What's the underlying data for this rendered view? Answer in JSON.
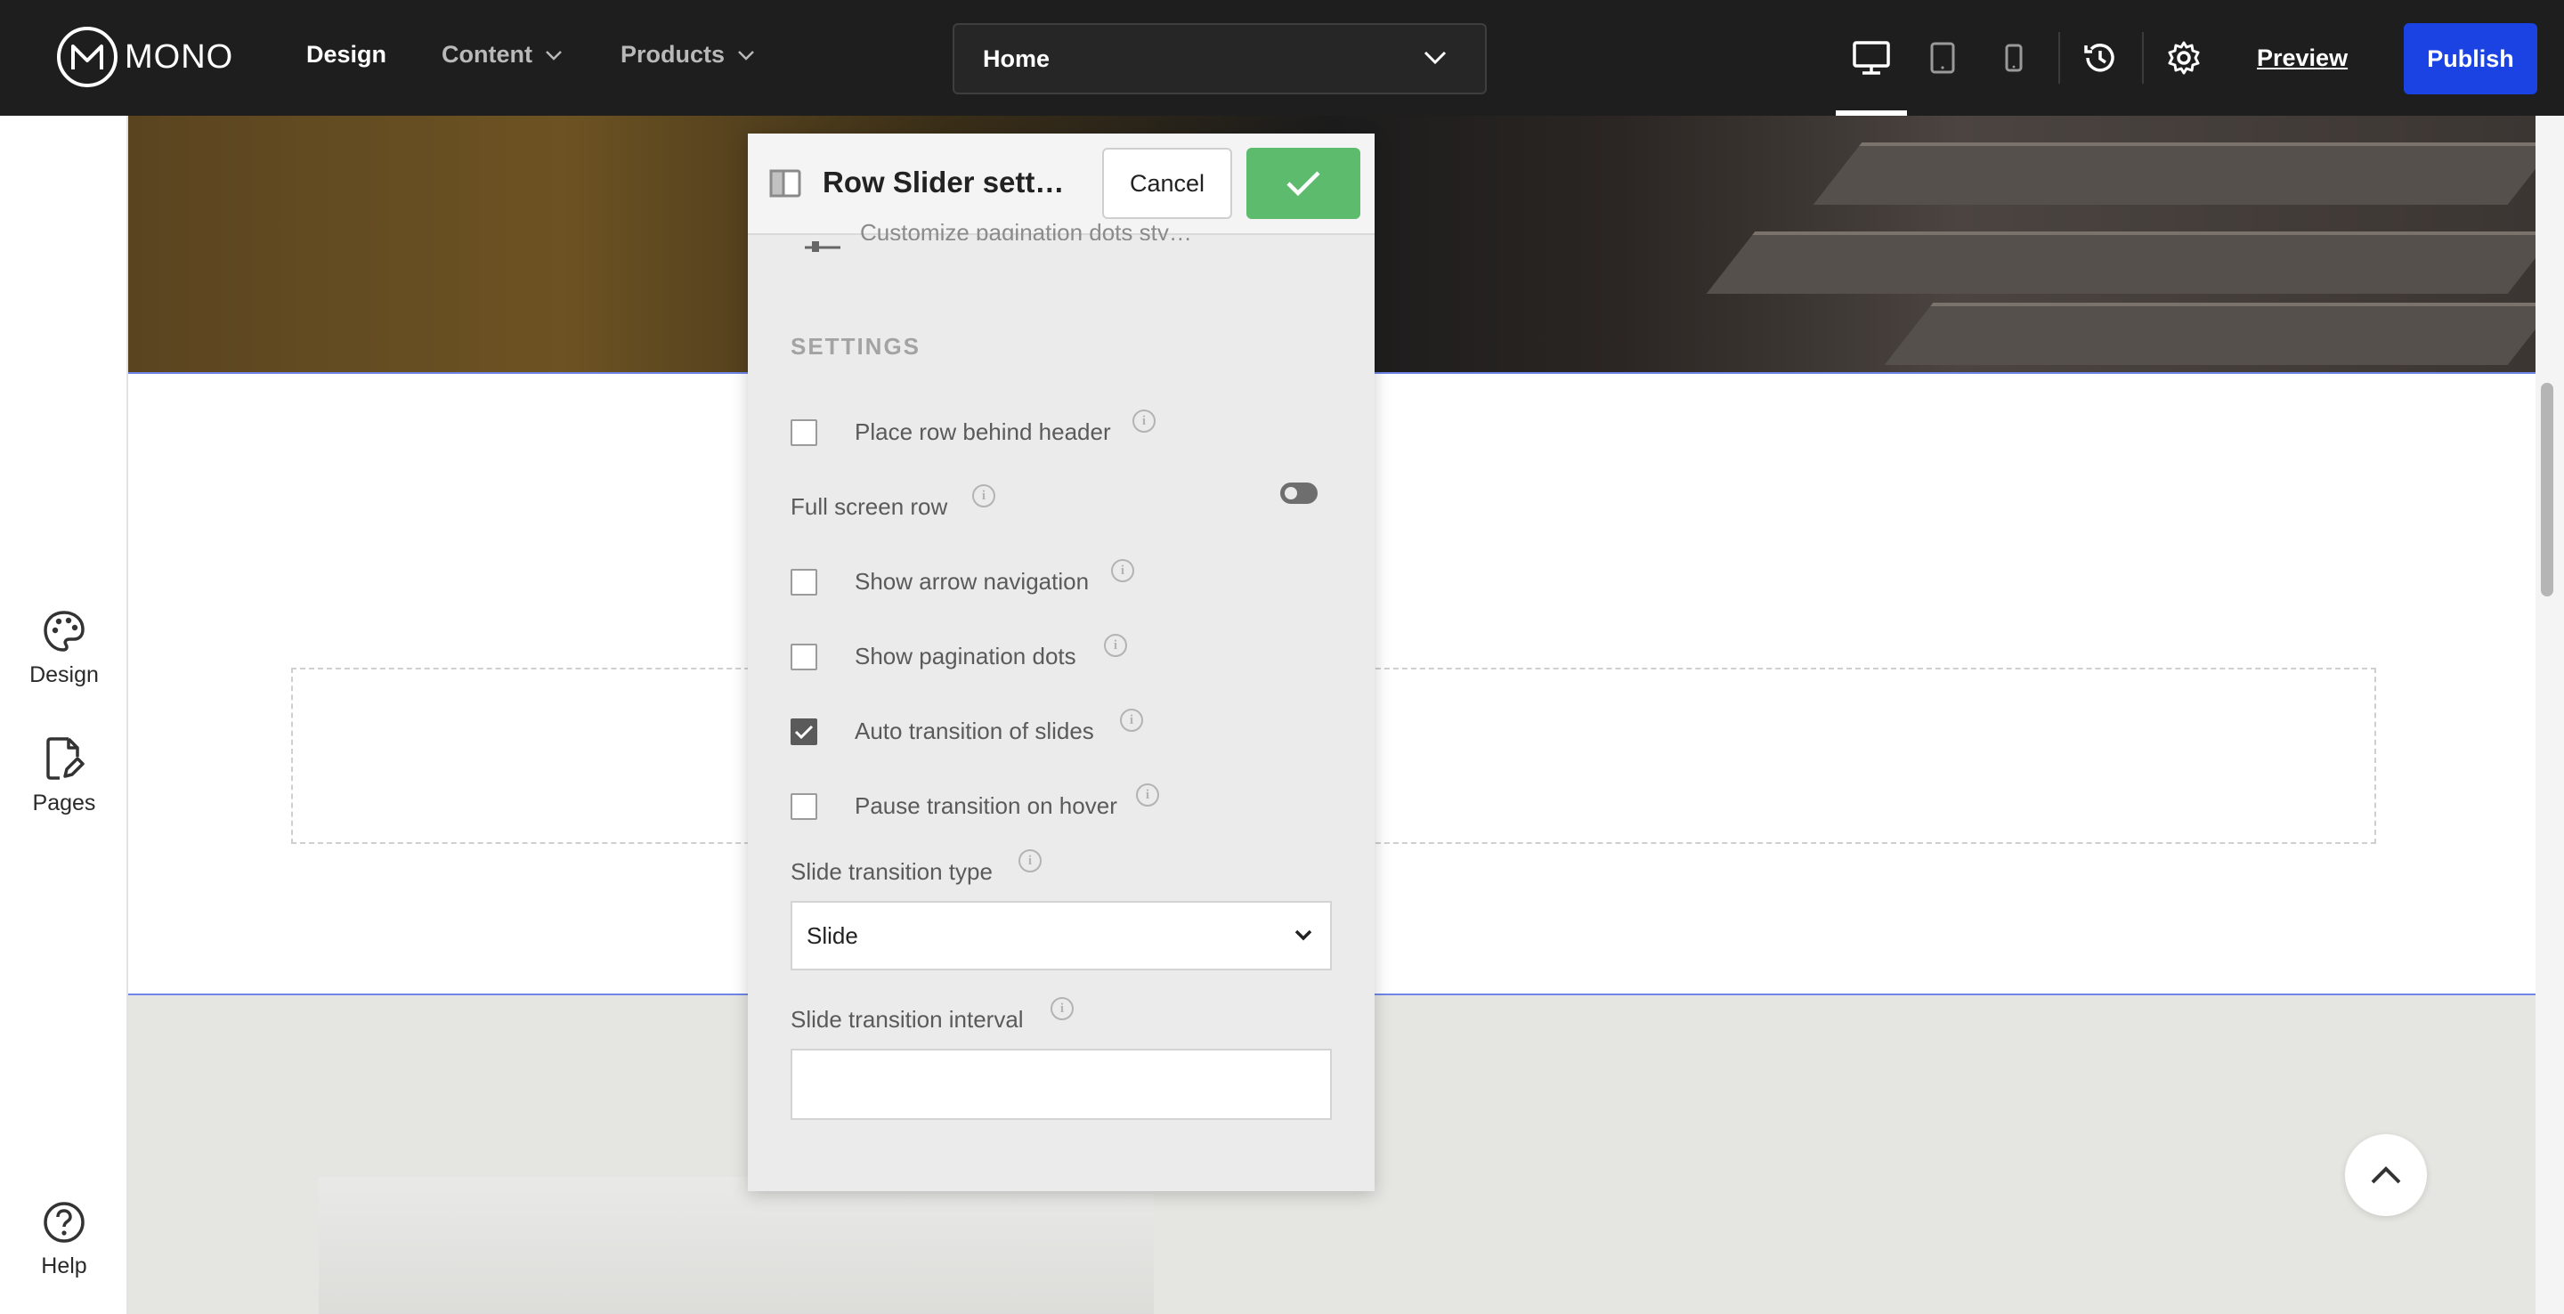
{
  "brand": {
    "logo_text": "MONO"
  },
  "nav": {
    "design": "Design",
    "content": "Content",
    "products": "Products"
  },
  "page_selector": {
    "value": "Home"
  },
  "topbar": {
    "preview": "Preview",
    "publish": "Publish",
    "publish_color": "#1b43e3"
  },
  "sidebar": {
    "design": "Design",
    "pages": "Pages",
    "help": "Help"
  },
  "panel": {
    "title": "Row Slider sett…",
    "cancel": "Cancel",
    "confirm_color": "#5dbb6e",
    "cut_off_text": "Customize pagination dots sty…",
    "section_title": "SETTINGS",
    "options": {
      "place_behind_header": {
        "label": "Place row behind header",
        "checked": false
      },
      "full_screen_row": {
        "label": "Full screen row",
        "on": false
      },
      "show_arrow_navigation": {
        "label": "Show arrow navigation",
        "checked": false
      },
      "show_pagination_dots": {
        "label": "Show pagination dots",
        "checked": false
      },
      "auto_transition": {
        "label": "Auto transition of slides",
        "checked": true
      },
      "pause_on_hover": {
        "label": "Pause transition on hover",
        "checked": false
      }
    },
    "transition_type": {
      "label": "Slide transition type",
      "value": "Slide"
    },
    "transition_interval": {
      "label": "Slide transition interval",
      "value": ""
    }
  }
}
